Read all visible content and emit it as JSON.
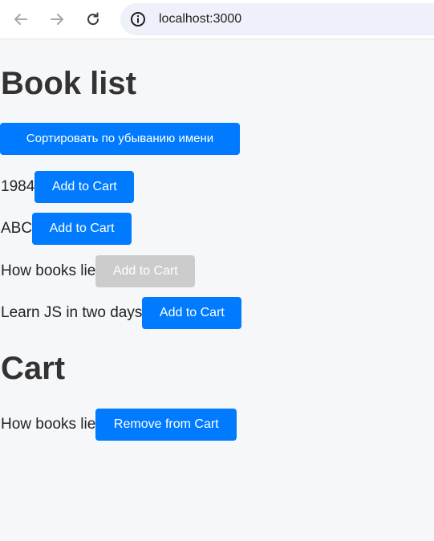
{
  "browser": {
    "url": "localhost:3000",
    "icons": {
      "back": "arrow-left-icon",
      "forward": "arrow-right-icon",
      "reload": "reload-icon",
      "info": "info-icon"
    }
  },
  "page": {
    "book_list_heading": "Book list",
    "sort_button_label": "Сортировать по убыванию имени",
    "books": [
      {
        "title": "1984",
        "button_label": "Add to Cart",
        "disabled": false
      },
      {
        "title": "ABC",
        "button_label": "Add to Cart",
        "disabled": false
      },
      {
        "title": "How books lie",
        "button_label": "Add to Cart",
        "disabled": true
      },
      {
        "title": "Learn JS in two days",
        "button_label": "Add to Cart",
        "disabled": false
      }
    ],
    "cart_heading": "Cart",
    "cart_items": [
      {
        "title": "How books lie",
        "button_label": "Remove from Cart"
      }
    ]
  },
  "colors": {
    "primary_button": "#007bff",
    "disabled_button": "#cccccc",
    "page_background": "#f6f7f9"
  }
}
